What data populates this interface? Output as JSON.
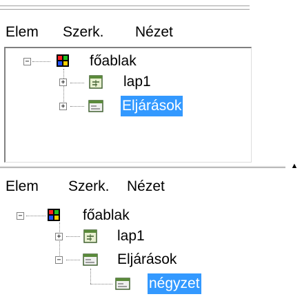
{
  "menus": [
    {
      "items": [
        "Elem",
        "Szerk.",
        "Nézet"
      ]
    },
    {
      "items": [
        "Elem",
        "Szerk.",
        "Nézet"
      ]
    }
  ],
  "tree1": {
    "root": {
      "label": "főablak",
      "expander": "−"
    },
    "children": [
      {
        "label": "lap1",
        "expander": "+",
        "icon": "form-icon",
        "selected": false
      },
      {
        "label": "Eljárások",
        "expander": "+",
        "icon": "procedures-icon",
        "selected": true
      }
    ]
  },
  "tree2": {
    "root": {
      "label": "főablak",
      "expander": "−"
    },
    "children": [
      {
        "label": "lap1",
        "expander": "+",
        "icon": "form-icon",
        "selected": false
      },
      {
        "label": "Eljárások",
        "expander": "−",
        "icon": "procedures-icon",
        "selected": false,
        "children": [
          {
            "label": "négyzet",
            "icon": "procedure-icon",
            "selected": true
          }
        ]
      }
    ]
  },
  "splitter": {
    "arrow": "▲"
  },
  "colors": {
    "selection": "#3399ff",
    "selection_text": "#ffffff",
    "border": "#808080"
  }
}
